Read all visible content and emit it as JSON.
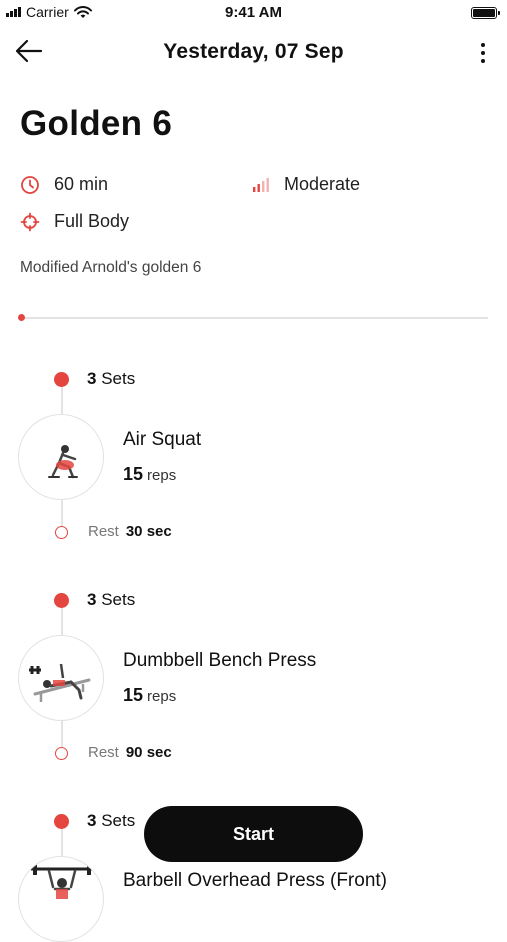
{
  "status_bar": {
    "carrier": "Carrier",
    "time": "9:41 AM"
  },
  "nav": {
    "title": "Yesterday, 07 Sep",
    "icons": {
      "back": "arrow-left-icon",
      "more": "more-vertical-icon"
    }
  },
  "workout": {
    "title": "Golden 6",
    "duration": "60 min",
    "intensity": "Moderate",
    "focus": "Full Body",
    "description": "Modified Arnold's golden 6",
    "progress": 0
  },
  "colors": {
    "accent": "#e5453f",
    "button": "#0d0d0d",
    "muted": "#777777"
  },
  "exercises": [
    {
      "sets_count": "3",
      "sets_word": "Sets",
      "name": "Air Squat",
      "reps_count": "15",
      "reps_word": "reps",
      "rest_label": "Rest",
      "rest_value": "30 sec"
    },
    {
      "sets_count": "3",
      "sets_word": "Sets",
      "name": "Dumbbell Bench Press",
      "reps_count": "15",
      "reps_word": "reps",
      "rest_label": "Rest",
      "rest_value": "90 sec"
    },
    {
      "sets_count": "3",
      "sets_word": "Sets",
      "name": "Barbell Overhead Press (Front)"
    }
  ],
  "actions": {
    "start_label": "Start"
  }
}
